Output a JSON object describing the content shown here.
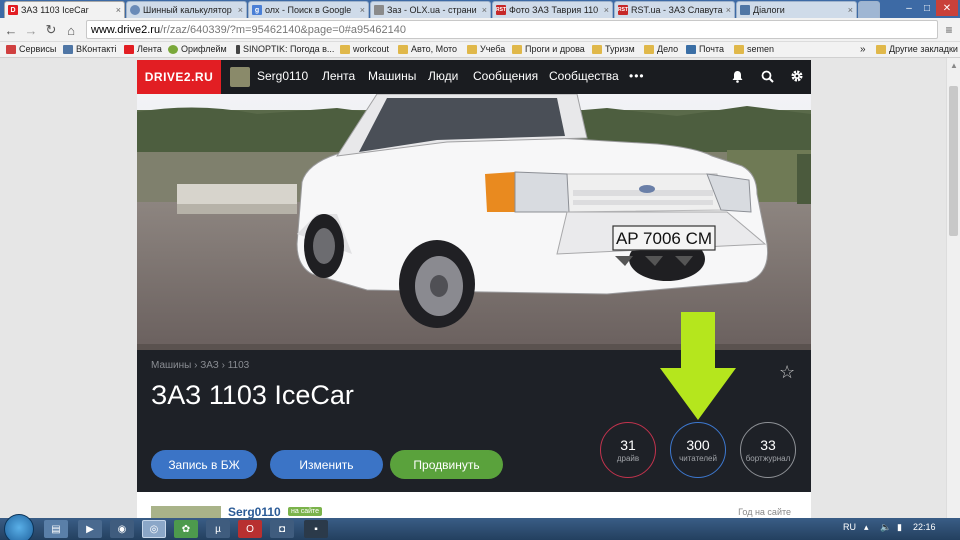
{
  "browser": {
    "tabs": [
      {
        "label": "ЗАЗ 1103 IceCar",
        "favicon": "drive2-favicon",
        "favicon_color": "#e21e23",
        "favicon_text": "D",
        "active": true
      },
      {
        "label": "Шинный калькулятор",
        "favicon": "globe-favicon",
        "favicon_color": "#6a8bb8",
        "favicon_text": "",
        "active": false
      },
      {
        "label": "олх - Поиск в Google",
        "favicon": "google-favicon",
        "favicon_color": "#4a7fd6",
        "favicon_text": "g",
        "active": false
      },
      {
        "label": "Заз - OLX.ua - страни",
        "favicon": "olx-favicon",
        "favicon_color": "#8a8a8a",
        "favicon_text": "",
        "active": false
      },
      {
        "label": "Фото ЗАЗ Таврия 110",
        "favicon": "rst-favicon",
        "favicon_color": "#c62828",
        "favicon_text": "RST",
        "active": false
      },
      {
        "label": "RST.ua - ЗАЗ Славута",
        "favicon": "rst-favicon",
        "favicon_color": "#c62828",
        "favicon_text": "RST",
        "active": false
      },
      {
        "label": "Діалоги",
        "favicon": "vk-favicon",
        "favicon_color": "#4f76a5",
        "favicon_text": "",
        "active": false
      }
    ],
    "tab_close_glyph": "×",
    "window_controls": [
      "–",
      "□",
      "✕"
    ],
    "nav": {
      "back": "←",
      "forward": "→",
      "reload": "↻",
      "home": "⌂"
    },
    "url_host": "www.drive2.ru",
    "url_path": "/r/zaz/640339/?m=95462140&page=0#a95462140",
    "bookmarks_left": [
      {
        "label": "Сервисы",
        "icon": "apps-grid-icon",
        "color": "#d04040"
      },
      {
        "label": "ВКонтакті",
        "icon": "vk-icon",
        "color": "#4f76a5"
      },
      {
        "label": "Лента",
        "icon": "drive2-icon",
        "color": "#e21e23"
      },
      {
        "label": "Орифлейм",
        "icon": "oriflame-icon",
        "color": "#7aa83a"
      },
      {
        "label": "SINOPTIK: Погода в...",
        "icon": "sinoptik-icon",
        "color": "#444444"
      },
      {
        "label": "workcout",
        "icon": "folder-icon",
        "color": "#e0b84a"
      },
      {
        "label": "Авто, Мото",
        "icon": "folder-icon",
        "color": "#e0b84a"
      },
      {
        "label": "Учеба",
        "icon": "folder-icon",
        "color": "#e0b84a"
      },
      {
        "label": "Проги и дрова",
        "icon": "folder-icon",
        "color": "#e0b84a"
      },
      {
        "label": "Туризм",
        "icon": "folder-icon",
        "color": "#e0b84a"
      },
      {
        "label": "Дело",
        "icon": "folder-icon",
        "color": "#e0b84a"
      },
      {
        "label": "Почта",
        "icon": "mail-icon",
        "color": "#3a6ea5"
      },
      {
        "label": "semen",
        "icon": "folder-icon",
        "color": "#e0b84a"
      }
    ],
    "bookmarks_more": "»",
    "bookmarks_other": "Другие закладки"
  },
  "site": {
    "logo": "DRIVE2.RU",
    "user": "Serg0110",
    "nav": [
      "Лента",
      "Машины",
      "Люди",
      "Сообщения",
      "Сообщества"
    ],
    "more": "•••",
    "header_icons": [
      "bell-icon",
      "search-icon",
      "gear-icon"
    ],
    "photo": {
      "plate": "AP 7006 CM"
    },
    "breadcrumbs": "Машины › ЗАЗ › 1103",
    "title": "ЗАЗ 1103 IceCar",
    "buttons": [
      {
        "label": "Запись в БЖ",
        "color": "#3b74c6"
      },
      {
        "label": "Изменить",
        "color": "#3b74c6"
      },
      {
        "label": "Продвинуть",
        "color": "#5aa23c"
      }
    ],
    "stats": [
      {
        "value": "31",
        "label": "драйв",
        "color": "#c2334d"
      },
      {
        "value": "300",
        "label": "читателей",
        "color": "#3d78cf"
      },
      {
        "value": "33",
        "label": "бортжурнал",
        "color": "#8e9196"
      }
    ],
    "arrow_color": "#b5e61d",
    "card": {
      "user": "Serg0110",
      "badge": "на сайте",
      "since": "Год на сайте"
    }
  },
  "taskbar": {
    "apps": [
      "explorer-icon",
      "media-player-icon",
      "aimp-icon",
      "chrome-icon",
      "icq-icon",
      "utorrent-icon",
      "opera-icon",
      "camera-icon",
      "terminal-icon"
    ],
    "lang": "RU",
    "time": "22:16"
  }
}
